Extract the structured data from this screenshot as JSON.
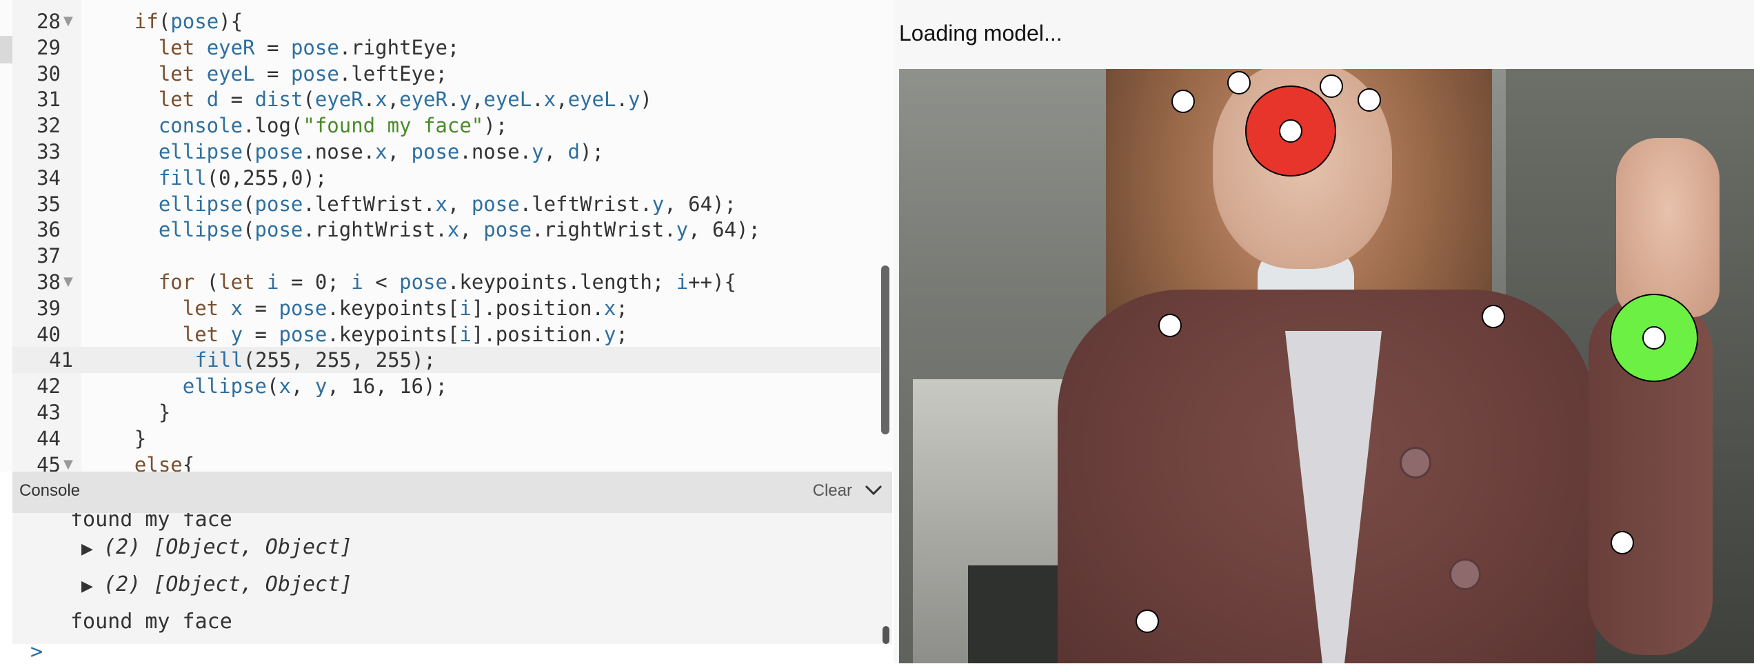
{
  "editor": {
    "lines": [
      {
        "num": "28",
        "fold": true,
        "text": "  if(pose){"
      },
      {
        "num": "29",
        "fold": false,
        "text": "    let eyeR = pose.rightEye;"
      },
      {
        "num": "30",
        "fold": false,
        "text": "    let eyeL = pose.leftEye;"
      },
      {
        "num": "31",
        "fold": false,
        "text": "    let d = dist(eyeR.x,eyeR.y,eyeL.x,eyeL.y)"
      },
      {
        "num": "32",
        "fold": false,
        "text": "    console.log(\"found my face\");"
      },
      {
        "num": "33",
        "fold": false,
        "text": "    ellipse(pose.nose.x, pose.nose.y, d);"
      },
      {
        "num": "34",
        "fold": false,
        "text": "    fill(0,255,0);"
      },
      {
        "num": "35",
        "fold": false,
        "text": "    ellipse(pose.leftWrist.x, pose.leftWrist.y, 64);"
      },
      {
        "num": "36",
        "fold": false,
        "text": "    ellipse(pose.rightWrist.x, pose.rightWrist.y, 64);"
      },
      {
        "num": "37",
        "fold": false,
        "text": ""
      },
      {
        "num": "38",
        "fold": true,
        "text": "    for (let i = 0; i < pose.keypoints.length; i++){"
      },
      {
        "num": "39",
        "fold": false,
        "text": "      let x = pose.keypoints[i].position.x;"
      },
      {
        "num": "40",
        "fold": false,
        "text": "      let y = pose.keypoints[i].position.y;"
      },
      {
        "num": "41",
        "fold": false,
        "text": "      fill(255, 255, 255);"
      },
      {
        "num": "42",
        "fold": false,
        "text": "      ellipse(x, y, 16, 16);"
      },
      {
        "num": "43",
        "fold": false,
        "text": "    }"
      },
      {
        "num": "44",
        "fold": false,
        "text": "  }"
      },
      {
        "num": "45",
        "fold": true,
        "text": "  else{"
      }
    ],
    "active_line": "41"
  },
  "console": {
    "title": "Console",
    "clear_label": "Clear",
    "messages": [
      {
        "type": "text",
        "text": "found my face"
      },
      {
        "type": "object",
        "text": "(2) [Object, Object]"
      },
      {
        "type": "object",
        "text": "(2) [Object, Object]"
      },
      {
        "type": "text",
        "text": "found my face"
      }
    ],
    "prompt": ">"
  },
  "preview": {
    "status": "Loading model...",
    "colors": {
      "nose": "#e7352b",
      "wrist": "#6cf044",
      "keypoint": "#ffffff"
    }
  }
}
